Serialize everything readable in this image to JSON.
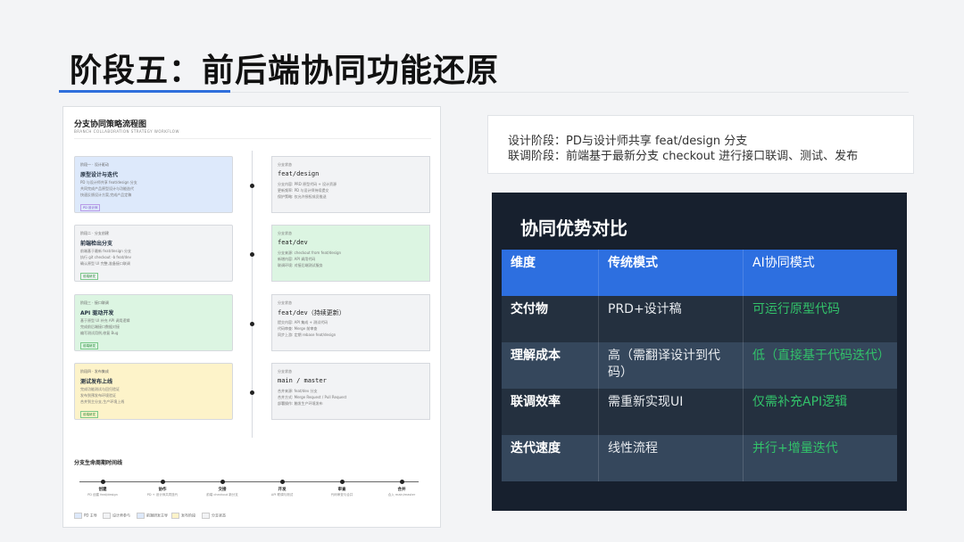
{
  "slide": {
    "title": "阶段五：前后端协同功能还原"
  },
  "doc": {
    "title": "分支协同策略流程图",
    "subtitle": "BRANCH COLLABORATION STRATEGY WORKFLOW",
    "left_cards": [
      {
        "tag": "阶段一 · 设计驱动",
        "title": "原型设计与迭代",
        "lines": [
          "PD 与设计师共享 feat/design 分支",
          "共同完成产品原型设计与功能迭代",
          "快速反馈设计方案,完成产品定稿"
        ],
        "badge": "PD  设计师"
      },
      {
        "tag": "阶段二 · 分支创建",
        "title": "前端检出分支",
        "lines": [
          "前端基于最新 feat/design 分支",
          "执行 git checkout -b feat/dev",
          "确认原型 UI 完整,准备接口联调"
        ],
        "badge": "前端研发"
      },
      {
        "tag": "阶段三 · 接口联调",
        "title": "API 驱动开发",
        "lines": [
          "基于原型 UI 补充 API 调用逻辑",
          "完成前后端接口数据对接",
          "编写测试用例,修复 Bug"
        ],
        "badge": "前端研发"
      },
      {
        "tag": "阶段四 · 发布集成",
        "title": "测试发布上线",
        "lines": [
          "完成功能测试与回归验证",
          "发布到预发布环境验证",
          "合并到主分支,生产环境上线"
        ],
        "badge": "前端研发"
      }
    ],
    "right_cards": [
      {
        "tag": "分支状态",
        "title": "feat/design",
        "lines": [
          "分支内容: PRD 原型代码 + 设计资源",
          "更新频率: PD 与设计师持续提交",
          "保护策略: 仅允许授权成员推送"
        ]
      },
      {
        "tag": "分支状态",
        "title": "feat/dev",
        "lines": [
          "分支来源: checkout from feat/design",
          "新增内容: API 调用代码",
          "联调环境: 对接后端测试服务"
        ]
      },
      {
        "tag": "分支状态",
        "title": "feat/dev（持续更新）",
        "lines": [
          "提交内容: API 集成 + 测试代码",
          "代码审查: Merge 前审查",
          "同步上游: 定期 rebase feat/design"
        ]
      },
      {
        "tag": "分支状态",
        "title": "main / master",
        "lines": [
          "合并来源: feat/dev 分支",
          "合并方式: Merge Request / Pull Request",
          "部署操作: 触发生产环境发布"
        ]
      }
    ],
    "timeline_title": "分支生命周期时间线",
    "timeline": [
      {
        "label": "创建",
        "desc": "PD 创建 feat/design"
      },
      {
        "label": "协作",
        "desc": "PD + 设计师共同迭代"
      },
      {
        "label": "交接",
        "desc": "前端 checkout 新分支"
      },
      {
        "label": "开发",
        "desc": "API 联调与测试"
      },
      {
        "label": "审查",
        "desc": "代码审查与合并"
      },
      {
        "label": "合并",
        "desc": "合入 main/master"
      }
    ],
    "legend": [
      "PD 主导",
      "设计师参与",
      "前端研发主导",
      "发布阶段",
      "分支状态"
    ]
  },
  "info": {
    "line1": "设计阶段：PD与设计师共享 feat/design 分支",
    "line2": "联调阶段：前端基于最新分支 checkout 进行接口联调、测试、发布"
  },
  "comparison": {
    "title": "协同优势对比",
    "headers": [
      "维度",
      "传统模式",
      "AI协同模式"
    ],
    "rows": [
      [
        "交付物",
        "PRD+设计稿",
        "可运行原型代码"
      ],
      [
        "理解成本",
        "高（需翻译设计到代码）",
        "低（直接基于代码迭代）"
      ],
      [
        "联调效率",
        "需重新实现UI",
        "仅需补充API逻辑"
      ],
      [
        "迭代速度",
        "线性流程",
        "并行+增量迭代"
      ]
    ]
  },
  "colors": {
    "accent": "#2f6fdc",
    "panel_bg": "#17202e",
    "header_blue": "#2d6fe0",
    "positive_green": "#32c26a",
    "card_blue": "#dde9fb",
    "card_gray": "#f2f3f5",
    "card_green": "#dcf5e2",
    "card_yellow": "#fdf3c9"
  }
}
